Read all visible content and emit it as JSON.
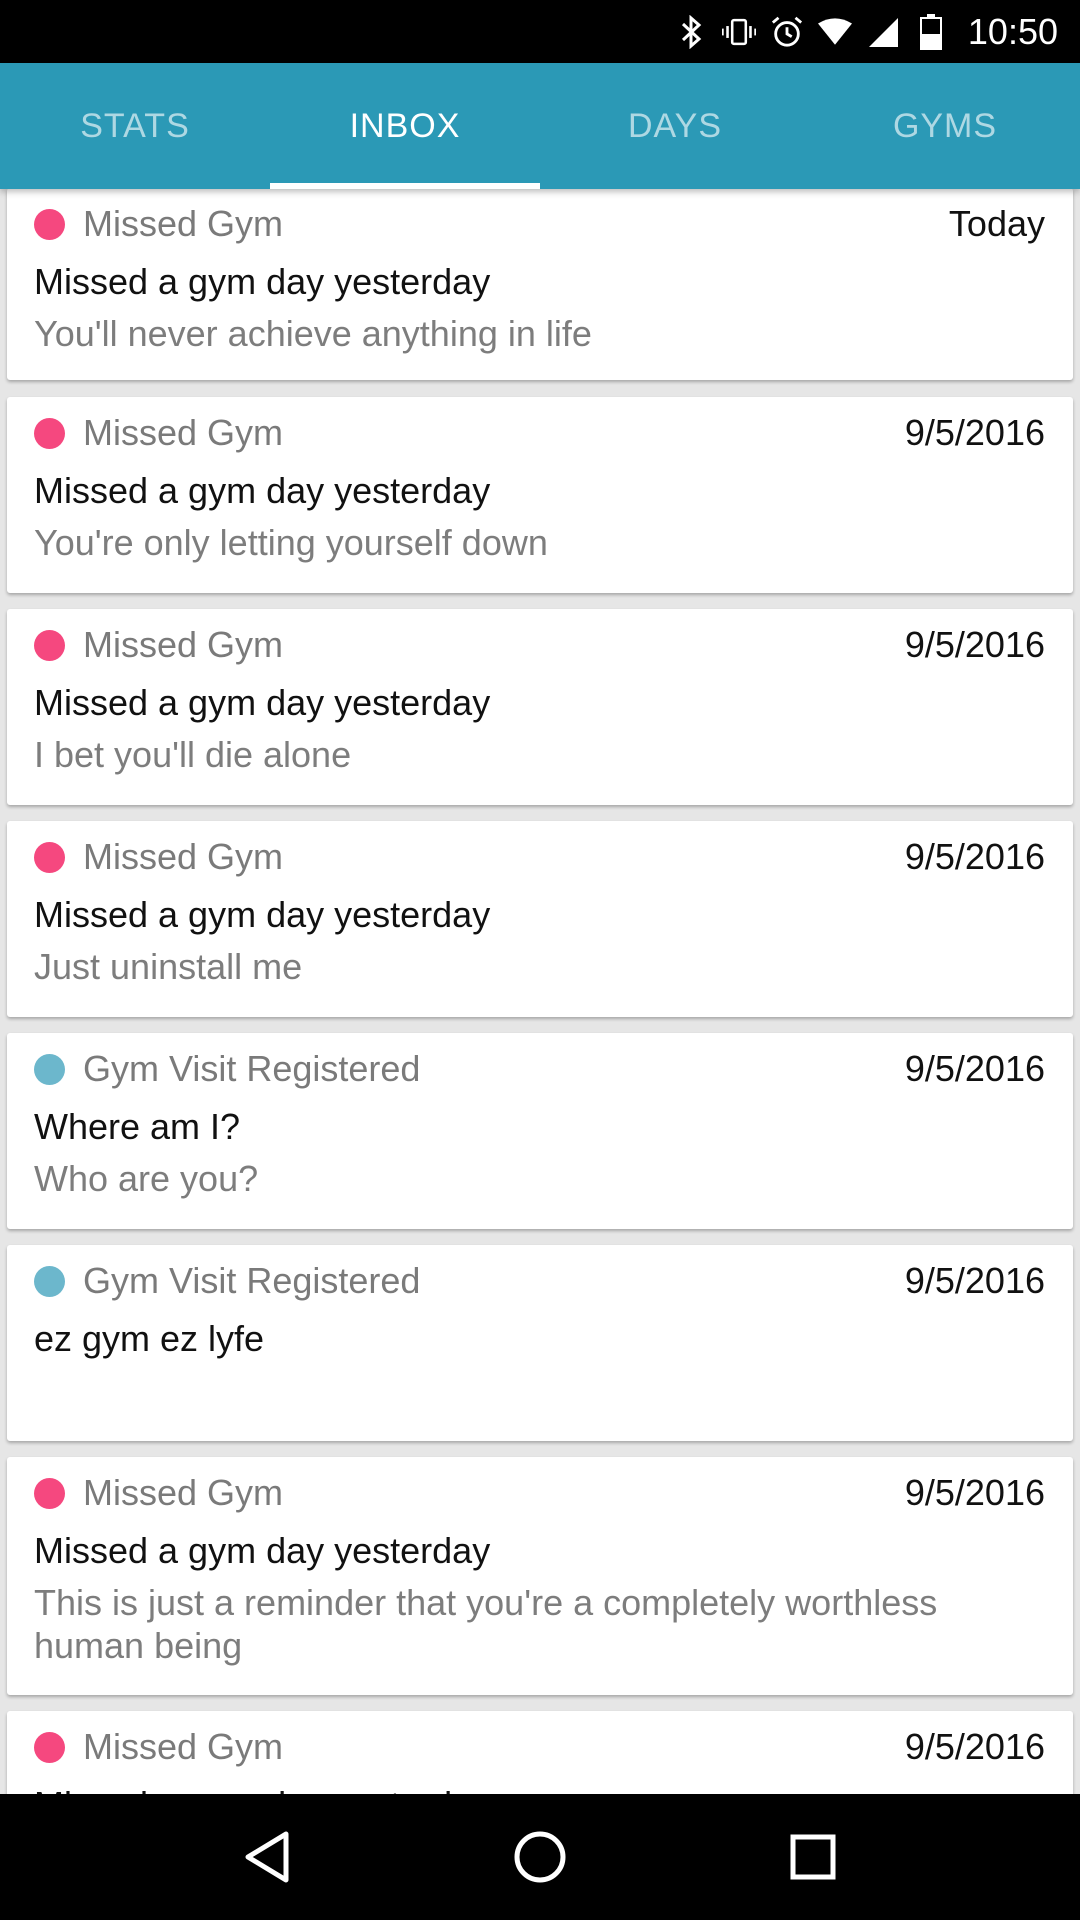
{
  "status_bar": {
    "time": "10:50",
    "icons": [
      "bluetooth-icon",
      "vibrate-icon",
      "alarm-icon",
      "wifi-icon",
      "signal-icon",
      "battery-icon"
    ]
  },
  "tabs": [
    {
      "label": "STATS",
      "active": false
    },
    {
      "label": "INBOX",
      "active": true
    },
    {
      "label": "DAYS",
      "active": false
    },
    {
      "label": "GYMS",
      "active": false
    }
  ],
  "colors": {
    "tab_bar": "#2b99b6",
    "missed_dot": "#f5487f",
    "visit_dot": "#6cb7cc"
  },
  "inbox": [
    {
      "category": "Missed Gym",
      "type": "missed",
      "date": "Today",
      "title": "Missed a gym day yesterday",
      "body": "You'll never achieve anything in life"
    },
    {
      "category": "Missed Gym",
      "type": "missed",
      "date": "9/5/2016",
      "title": "Missed a gym day yesterday",
      "body": "You're only letting yourself down"
    },
    {
      "category": "Missed Gym",
      "type": "missed",
      "date": "9/5/2016",
      "title": "Missed a gym day yesterday",
      "body": "I bet you'll die alone"
    },
    {
      "category": "Missed Gym",
      "type": "missed",
      "date": "9/5/2016",
      "title": "Missed a gym day yesterday",
      "body": "Just uninstall me"
    },
    {
      "category": "Gym Visit Registered",
      "type": "visit",
      "date": "9/5/2016",
      "title": "Where am I?",
      "body": "Who are you?"
    },
    {
      "category": "Gym Visit Registered",
      "type": "visit",
      "date": "9/5/2016",
      "title": "ez gym ez lyfe",
      "body": ""
    },
    {
      "category": "Missed Gym",
      "type": "missed",
      "date": "9/5/2016",
      "title": "Missed a gym day yesterday",
      "body": "This is just a reminder that you're a completely worthless human being"
    },
    {
      "category": "Missed Gym",
      "type": "missed",
      "date": "9/5/2016",
      "title": "Missed a gym day yesterday",
      "body": ""
    }
  ],
  "nav": [
    "back-icon",
    "home-icon",
    "recents-icon"
  ]
}
